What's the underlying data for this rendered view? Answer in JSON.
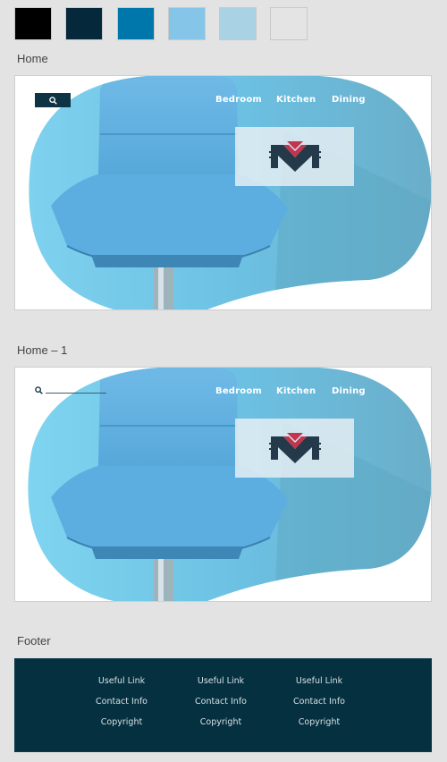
{
  "palette": {
    "swatches": [
      "#000000",
      "#05293a",
      "#0077aa",
      "#85c6e8",
      "#a9d3e5",
      "#e4e4e4"
    ]
  },
  "artboards": [
    {
      "label": "Home",
      "nav": [
        "Bedroom",
        "Kitchen",
        "Dining"
      ],
      "search_style": "button",
      "icons": {
        "search": "search-icon",
        "logo": "m-logo-icon"
      }
    },
    {
      "label": "Home – 1",
      "nav": [
        "Bedroom",
        "Kitchen",
        "Dining"
      ],
      "search_style": "underline",
      "icons": {
        "search": "search-icon",
        "logo": "m-logo-icon"
      }
    }
  ],
  "footer": {
    "label": "Footer",
    "columns": [
      {
        "useful_link": "Useful Link",
        "contact_info": "Contact Info",
        "copyright": "Copyright"
      },
      {
        "useful_link": "Useful Link",
        "contact_info": "Contact Info",
        "copyright": "Copyright"
      },
      {
        "useful_link": "Useful Link",
        "contact_info": "Contact Info",
        "copyright": "Copyright"
      }
    ]
  },
  "colors": {
    "hero_blue": "#5fb8dd",
    "footer_bg": "#05303f",
    "logo_red": "#c4344d",
    "logo_dark": "#243a4a"
  }
}
